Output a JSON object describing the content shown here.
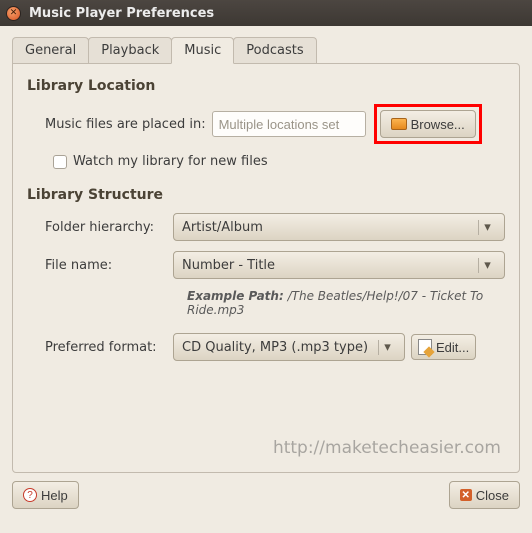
{
  "window": {
    "title": "Music Player Preferences"
  },
  "tabs": {
    "general": "General",
    "playback": "Playback",
    "music": "Music",
    "podcasts": "Podcasts"
  },
  "location": {
    "heading": "Library Location",
    "placed_label": "Music files are placed in:",
    "placed_value": "Multiple locations set",
    "browse": "Browse...",
    "watch": "Watch my library for new files"
  },
  "structure": {
    "heading": "Library Structure",
    "folder_label": "Folder hierarchy:",
    "folder_value": "Artist/Album",
    "file_label": "File name:",
    "file_value": "Number - Title",
    "example_label": "Example Path:",
    "example_value": "/The Beatles/Help!/07 - Ticket To Ride.mp3",
    "format_label": "Preferred format:",
    "format_value": "CD Quality, MP3 (.mp3 type)",
    "edit": "Edit..."
  },
  "footer": {
    "help": "Help",
    "close": "Close"
  },
  "watermark": "http://maketecheasier.com"
}
